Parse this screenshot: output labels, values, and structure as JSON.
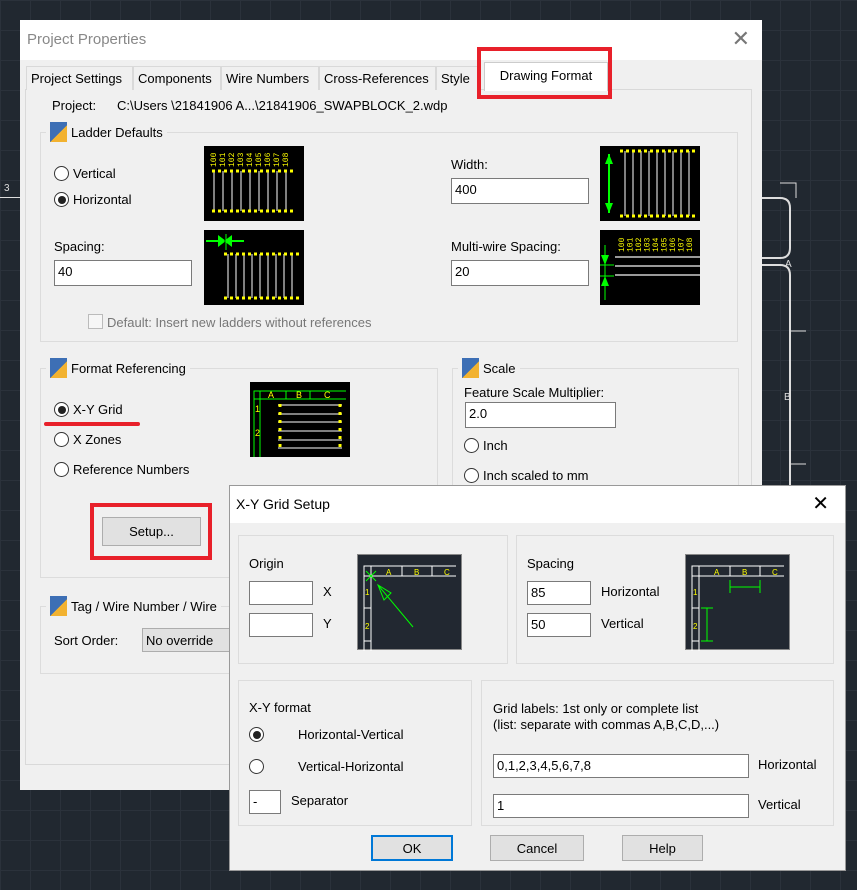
{
  "background": {
    "left_label": "3",
    "zone_labels": [
      "A",
      "B"
    ]
  },
  "main": {
    "title": "Project Properties",
    "tabs": [
      {
        "label": "Project Settings"
      },
      {
        "label": "Components"
      },
      {
        "label": "Wire Numbers"
      },
      {
        "label": "Cross-References"
      },
      {
        "label": "Style"
      },
      {
        "label": "Drawing Format",
        "active": true
      }
    ],
    "project_label": "Project:",
    "project_path": "C:\\Users \\21841906 A...\\21841906_SWAPBLOCK_2.wdp",
    "ladder": {
      "title": "Ladder Defaults",
      "vertical": "Vertical",
      "horizontal": "Horizontal",
      "selected": "Horizontal",
      "spacing_label": "Spacing:",
      "spacing": "40",
      "width_label": "Width:",
      "width": "400",
      "multiwire_label": "Multi-wire Spacing:",
      "multiwire": "20",
      "default_checkbox": "Default: Insert new ladders without references",
      "default_checked": false,
      "preview_numbers": [
        "100",
        "101",
        "102",
        "103",
        "104",
        "105",
        "106",
        "107",
        "108"
      ]
    },
    "format": {
      "title": "Format Referencing",
      "options": [
        "X-Y Grid",
        "X Zones",
        "Reference Numbers"
      ],
      "selected": "X-Y Grid",
      "setup_button": "Setup...",
      "preview_cols": [
        "A",
        "B",
        "C"
      ],
      "preview_rows": [
        "1",
        "2"
      ]
    },
    "scale": {
      "title": "Scale",
      "multiplier_label": "Feature Scale Multiplier:",
      "multiplier": "2.0",
      "inch": "Inch",
      "inch_mm": "Inch scaled to mm"
    },
    "tag": {
      "title": "Tag / Wire Number / Wire",
      "sort_label": "Sort Order:",
      "sort_value": "No override"
    }
  },
  "xy": {
    "title": "X-Y Grid Setup",
    "origin": {
      "title": "Origin",
      "x_label": "X",
      "y_label": "Y",
      "x": "",
      "y": ""
    },
    "spacing": {
      "title": "Spacing",
      "horizontal_label": "Horizontal",
      "vertical_label": "Vertical",
      "horizontal": "85",
      "vertical": "50"
    },
    "format": {
      "title": "X-Y format",
      "hv": "Horizontal-Vertical",
      "vh": "Vertical-Horizontal",
      "selected": "Horizontal-Vertical",
      "separator_label": "Separator",
      "separator": "-"
    },
    "labels": {
      "line1": "Grid labels: 1st only or complete list",
      "line2": "(list: separate with commas A,B,C,D,...)",
      "horizontal_label": "Horizontal",
      "vertical_label": "Vertical",
      "horizontal": "0,1,2,3,4,5,6,7,8",
      "vertical": "1"
    },
    "ok": "OK",
    "cancel": "Cancel",
    "help": "Help"
  },
  "colors": {
    "highlight": "#e8202a",
    "accent": "#0078d7",
    "preview_yellow": "#ffff00",
    "preview_green": "#00ff00"
  }
}
